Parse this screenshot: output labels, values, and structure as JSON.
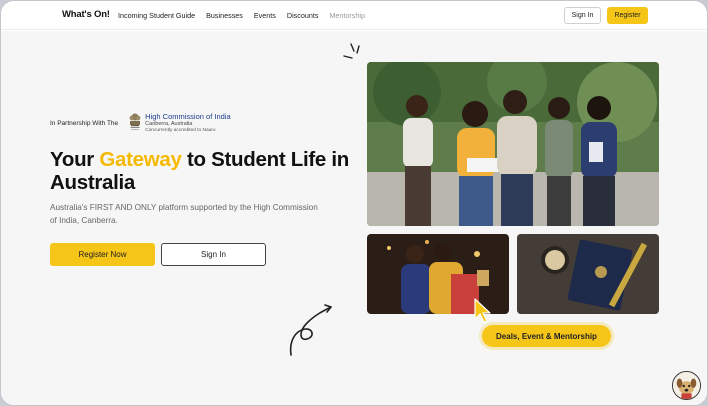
{
  "nav": {
    "logo": "What's On!",
    "links": [
      "Incoming Student Guide",
      "Businesses",
      "Events",
      "Discounts",
      "Mentorship"
    ],
    "signin_label": "Sign In",
    "register_label": "Register"
  },
  "partner": {
    "prefix": "In Partnership With The",
    "org_name": "High Commission of India",
    "location": "Canberra, Australia",
    "accreditation": "Concurrently accredited to Nauru"
  },
  "hero": {
    "headline_before": "Your ",
    "headline_accent": "Gateway",
    "headline_after": " to Student Life in Australia",
    "subtext": "Australia's FIRST AND ONLY platform supported by the High Commission of India, Canberra.",
    "register_now_label": "Register Now",
    "signin_label": "Sign In"
  },
  "badge": {
    "label": "Deals, Event & Mentorship"
  },
  "colors": {
    "accent": "#f5c518",
    "accent_text": "#f5b900",
    "commission_blue": "#1a3c8c"
  },
  "icons": {
    "cursor": "pointer-cursor-icon",
    "avatar": "dog-avatar-icon",
    "emblem": "india-emblem-icon"
  }
}
